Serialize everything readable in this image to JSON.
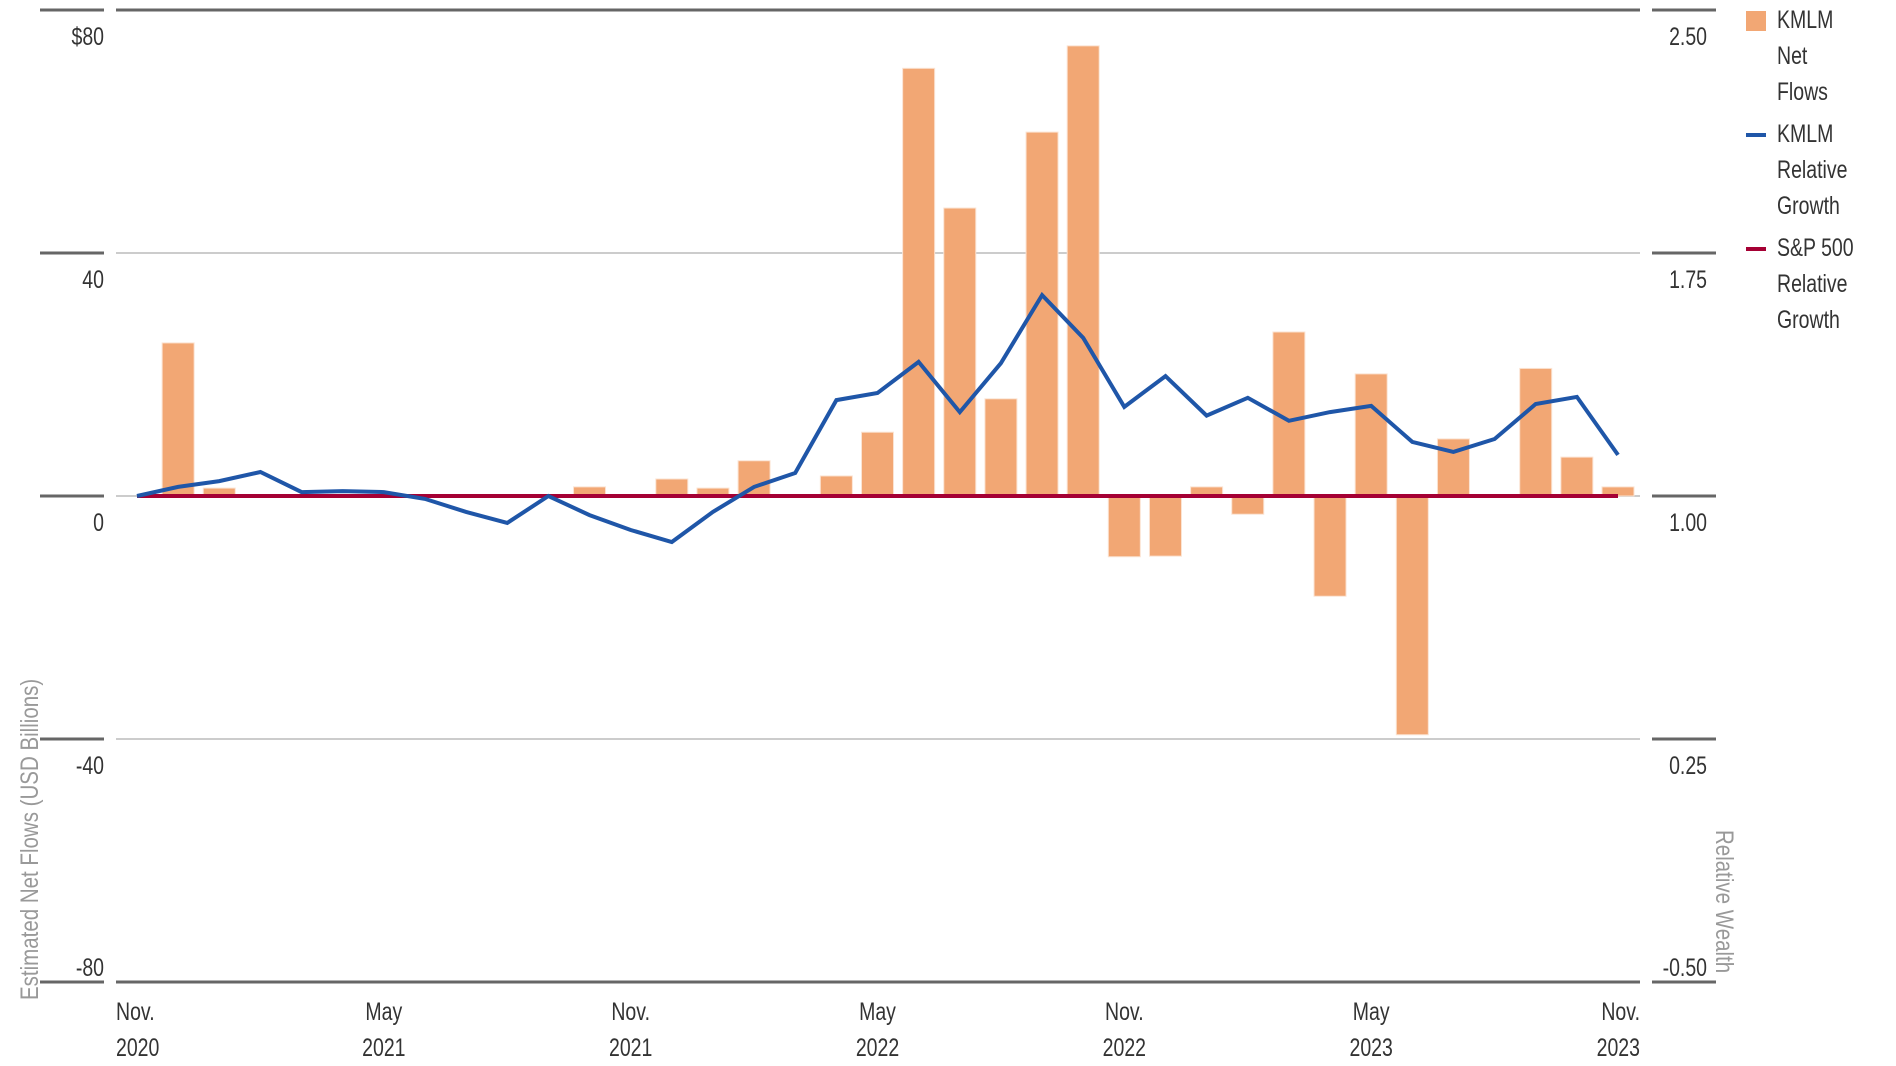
{
  "chart_data": {
    "type": "bar",
    "title": "",
    "xlabel": "",
    "ylabel": "Estimated Net Flows (USD Billions)",
    "y2label": "Relative Wealth",
    "ylim": [
      -80,
      80
    ],
    "y2lim": [
      -0.5,
      2.5
    ],
    "yticks": [
      "$80",
      "40",
      "0",
      "-40",
      "-80"
    ],
    "ytick_values": [
      80,
      40,
      0,
      -40,
      -80
    ],
    "y2ticks": [
      "2.50",
      "1.75",
      "1.00",
      "0.25",
      "-0.50"
    ],
    "y2tick_values": [
      2.5,
      1.75,
      1.0,
      0.25,
      -0.5
    ],
    "grid": true,
    "legend_position": "right",
    "x": [
      "Nov 2020",
      "Dec 2020",
      "Jan 2021",
      "Feb 2021",
      "Mar 2021",
      "Apr 2021",
      "May 2021",
      "Jun 2021",
      "Jul 2021",
      "Aug 2021",
      "Sep 2021",
      "Oct 2021",
      "Nov 2021",
      "Dec 2021",
      "Jan 2022",
      "Feb 2022",
      "Mar 2022",
      "Apr 2022",
      "May 2022",
      "Jun 2022",
      "Jul 2022",
      "Aug 2022",
      "Sep 2022",
      "Oct 2022",
      "Nov 2022",
      "Dec 2022",
      "Jan 2023",
      "Feb 2023",
      "Mar 2023",
      "Apr 2023",
      "May 2023",
      "Jun 2023",
      "Jul 2023",
      "Aug 2023",
      "Sep 2023",
      "Oct 2023",
      "Nov 2023"
    ],
    "xticks": [
      {
        "index": 0,
        "line1": "Nov.",
        "line2": "2020",
        "align": "start"
      },
      {
        "index": 6,
        "line1": "May",
        "line2": "2021",
        "align": "middle"
      },
      {
        "index": 12,
        "line1": "Nov.",
        "line2": "2021",
        "align": "middle"
      },
      {
        "index": 18,
        "line1": "May",
        "line2": "2022",
        "align": "middle"
      },
      {
        "index": 24,
        "line1": "Nov.",
        "line2": "2022",
        "align": "middle"
      },
      {
        "index": 30,
        "line1": "May",
        "line2": "2023",
        "align": "middle"
      },
      {
        "index": 36,
        "line1": "Nov.",
        "line2": "2023",
        "align": "end"
      }
    ],
    "series": [
      {
        "name": "KMLM Net Flows",
        "type": "bar",
        "axis": "left",
        "color": "#F2A774",
        "values": [
          0,
          25.2,
          1.3,
          0,
          0,
          0,
          0,
          0,
          0,
          0,
          0,
          1.5,
          0,
          2.8,
          1.3,
          5.8,
          0,
          3.3,
          10.5,
          70.4,
          47.4,
          16.0,
          59.9,
          74.1,
          -10.0,
          -9.9,
          1.5,
          -3.0,
          27.0,
          -16.5,
          20.1,
          -39.3,
          9.4,
          0,
          21.0,
          6.4,
          1.5
        ]
      },
      {
        "name": "KMLM Relative Growth",
        "type": "line",
        "axis": "right",
        "color": "#1F56A8",
        "values": [
          1.0,
          1.028,
          1.046,
          1.074,
          1.012,
          1.015,
          1.012,
          0.991,
          0.951,
          0.917,
          1.0,
          0.941,
          0.895,
          0.858,
          0.951,
          1.028,
          1.071,
          1.296,
          1.318,
          1.414,
          1.259,
          1.41,
          1.62,
          1.488,
          1.275,
          1.37,
          1.248,
          1.303,
          1.232,
          1.259,
          1.278,
          1.167,
          1.136,
          1.176,
          1.284,
          1.306,
          1.127
        ]
      },
      {
        "name": "S&P 500 Relative Growth",
        "type": "line",
        "axis": "right",
        "color": "#A50034",
        "values": [
          1.0,
          1.0,
          1.0,
          1.0,
          1.0,
          1.0,
          1.0,
          1.0,
          1.0,
          1.0,
          1.0,
          1.0,
          1.0,
          1.0,
          1.0,
          1.0,
          1.0,
          1.0,
          1.0,
          1.0,
          1.0,
          1.0,
          1.0,
          1.0,
          1.0,
          1.0,
          1.0,
          1.0,
          1.0,
          1.0,
          1.0,
          1.0,
          1.0,
          1.0,
          1.0,
          1.0,
          1.0
        ]
      }
    ]
  },
  "legend": {
    "items": [
      {
        "label": "KMLM\nNet\nFlows",
        "kind": "box",
        "color": "#F2A774"
      },
      {
        "label": "KMLM\nRelative\nGrowth",
        "kind": "line",
        "color": "#1F56A8"
      },
      {
        "label": "S&P 500\nRelative\nGrowth",
        "kind": "line",
        "color": "#A50034"
      }
    ]
  }
}
